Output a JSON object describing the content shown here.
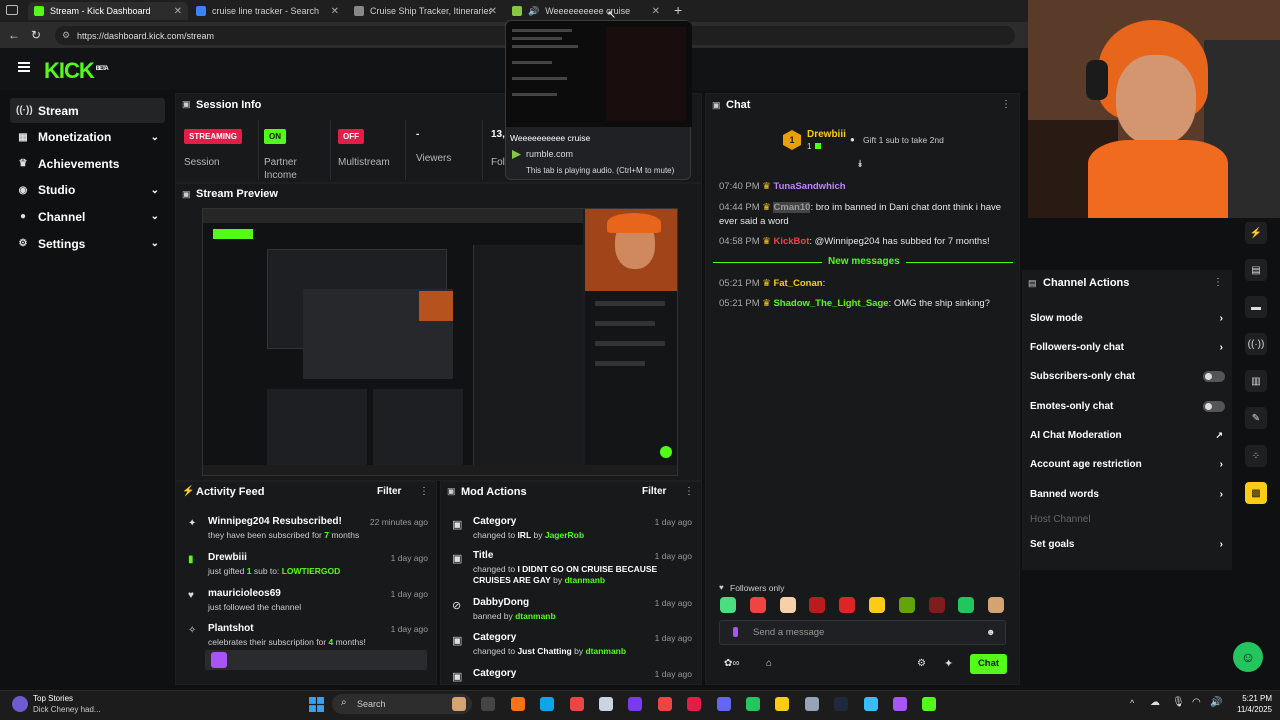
{
  "browser": {
    "tabs": [
      {
        "title": "Stream - Kick Dashboard",
        "color": "#53fc18"
      },
      {
        "title": "cruise line tracker - Search",
        "color": "#3b82f6"
      },
      {
        "title": "Cruise Ship Tracker, Itineraries, Sc",
        "color": "#888888"
      },
      {
        "title": "Weeeeeeeeee cruise",
        "color": "#85c742"
      }
    ],
    "url": "https://dashboard.kick.com/stream",
    "tooltip": {
      "title": "Weeeeeeeeee cruise",
      "domain": "rumble.com",
      "note": "This tab is playing audio. (Ctrl+M to mute)"
    }
  },
  "brand": {
    "logo": "KICK",
    "tag": "BETA",
    "accent": "#53fc18"
  },
  "sidebar": [
    {
      "label": "Stream",
      "icon": "radio-icon",
      "chevron": false
    },
    {
      "label": "Monetization",
      "icon": "wallet-icon",
      "chevron": true
    },
    {
      "label": "Achievements",
      "icon": "trophy-icon",
      "chevron": false
    },
    {
      "label": "Studio",
      "icon": "studio-icon",
      "chevron": true
    },
    {
      "label": "Channel",
      "icon": "user-icon",
      "chevron": true
    },
    {
      "label": "Settings",
      "icon": "gear-icon",
      "chevron": true
    }
  ],
  "session": {
    "title": "Session Info",
    "items": [
      {
        "badge": "STREAMING",
        "label": "Session"
      },
      {
        "badge": "ON",
        "label": "Partner Income"
      },
      {
        "badge": "OFF",
        "label": "Multistream"
      },
      {
        "badge": "-",
        "label": "Viewers"
      },
      {
        "badge": "13,",
        "label": "Fol"
      }
    ]
  },
  "preview": {
    "title": "Stream Preview"
  },
  "activity": {
    "title": "Activity Feed",
    "filter": "Filter",
    "items": [
      {
        "name": "Winnipeg204 Resubscribed!",
        "sub1": "they have been subscribed for ",
        "hl": "7",
        "sub2": " months",
        "time": "22 minutes ago"
      },
      {
        "name": "Drewbiii",
        "sub1": "just gifted ",
        "hl": "1",
        "sub2": " sub to: ",
        "hl2": "LOWTIERGOD",
        "time": "1 day ago"
      },
      {
        "name": "mauricioleos69",
        "sub1": "just followed the channel",
        "time": "1 day ago"
      },
      {
        "name": "Plantshot",
        "sub1": "celebrates their subscription for ",
        "hl": "4",
        "sub2": " months!",
        "time": "1 day ago"
      }
    ]
  },
  "mod": {
    "title": "Mod Actions",
    "filter": "Filter",
    "items": [
      {
        "name": "Category",
        "sub1": "changed to ",
        "hl": "IRL",
        "sub2": " by ",
        "hl2": "JagerRob",
        "time": "1 day ago"
      },
      {
        "name": "Title",
        "sub1": "changed to ",
        "hl": "I DIDNT GO ON CRUISE BECAUSE CRUISES ARE GAY",
        "sub2": " by ",
        "hl2": "dtanmanb",
        "time": "1 day ago"
      },
      {
        "name": "DabbyDong",
        "sub1": "banned by ",
        "hl2": "dtanmanb",
        "time": "1 day ago"
      },
      {
        "name": "Category",
        "sub1": "changed to ",
        "hl": "Just Chatting",
        "sub2": " by ",
        "hl2": "dtanmanb",
        "time": "1 day ago"
      },
      {
        "name": "Category",
        "time": "1 day ago"
      }
    ]
  },
  "chat": {
    "title": "Chat",
    "top_gifter": {
      "rank": "1",
      "name": "Drewbiii",
      "count": "1",
      "note": "Gift 1 sub to take 2nd"
    },
    "messages": [
      {
        "time": "07:40 PM",
        "user": "TunaSandwhich",
        "color": "#c084fc",
        "text": ""
      },
      {
        "time": "04:44 PM",
        "user": "Cman10",
        "color": "#999999",
        "text": ": bro im banned in Dani chat dont think i have ever said a word"
      },
      {
        "time": "04:58 PM",
        "user": "KickBot",
        "color": "#ef4444",
        "text": ": @Winnipeg204 has subbed for 7 months!"
      }
    ],
    "new_messages": "New messages",
    "messages_new": [
      {
        "time": "05:21 PM",
        "user": "Fat_Conan",
        "color": "#facc15",
        "text": ":"
      },
      {
        "time": "05:21 PM",
        "user": "Shadow_The_Light_Sage",
        "color": "#53fc18",
        "text": ": OMG the ship sinking?"
      }
    ],
    "followers_only": "Followers only",
    "placeholder": "Send a message",
    "send": "Chat"
  },
  "channel_actions": {
    "title": "Channel Actions",
    "items": [
      {
        "label": "Slow mode",
        "ctl": "chevron"
      },
      {
        "label": "Followers-only chat",
        "ctl": "chevron"
      },
      {
        "label": "Subscribers-only chat",
        "ctl": "toggle"
      },
      {
        "label": "Emotes-only chat",
        "ctl": "toggle"
      },
      {
        "label": "AI Chat Moderation",
        "ctl": "external"
      },
      {
        "label": "Account age restriction",
        "ctl": "chevron"
      },
      {
        "label": "Banned words",
        "ctl": "chevron"
      },
      {
        "label": "Host Channel",
        "ctl": "none",
        "disabled": true
      },
      {
        "label": "Set goals",
        "ctl": "chevron"
      }
    ]
  },
  "taskbar": {
    "news_title": "Top Stories",
    "news_sub": "Dick Cheney had...",
    "search": "Search",
    "time": "5:21 PM",
    "date": "11/4/2025"
  }
}
